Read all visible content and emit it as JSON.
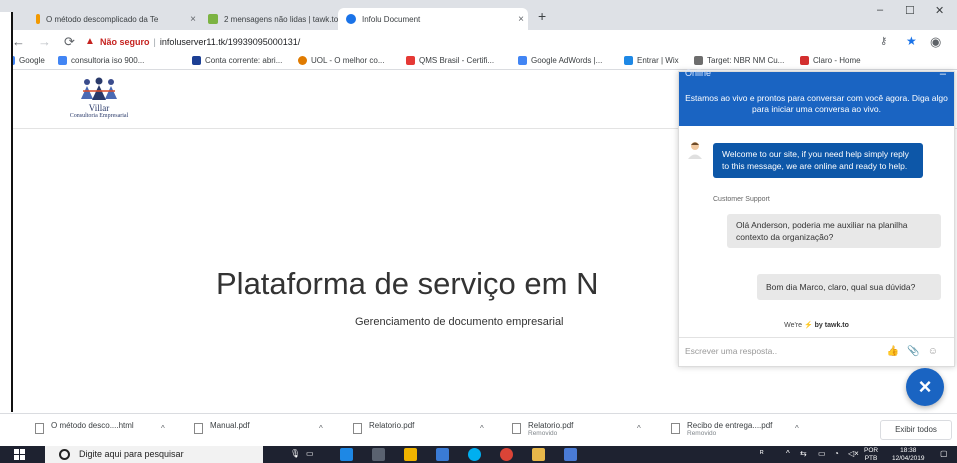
{
  "browser": {
    "tabs": [
      {
        "title": "O método descomplicado da Te",
        "icon_color": "#f29900",
        "active": false
      },
      {
        "title": "2 mensagens não lidas | tawk.to",
        "icon_color": "#7cb342",
        "active": false
      },
      {
        "title": "Infolu Document",
        "icon_color": "#1a73e8",
        "active": true
      }
    ],
    "new_tab_label": "+",
    "window_controls": [
      "–",
      "☐",
      "✕"
    ],
    "address": {
      "security": "Não seguro",
      "url": "infoluserver11.tk/19939095000131/"
    },
    "bookmarks": [
      {
        "label": "Google",
        "icon_color": "#4285f4"
      },
      {
        "label": "consultoria iso 900...",
        "icon_color": "#4285f4"
      },
      {
        "label": "Conta corrente: abri...",
        "icon_color": "#1c3f94"
      },
      {
        "label": "UOL - O melhor co...",
        "icon_color": "#e07b00"
      },
      {
        "label": "QMS Brasil - Certifi...",
        "icon_color": "#e53935"
      },
      {
        "label": "Google AdWords |...",
        "icon_color": "#4285f4"
      },
      {
        "label": "Entrar | Wix",
        "icon_color": "#1e88e5"
      },
      {
        "label": "Target: NBR NM Cu...",
        "icon_color": "#6d6d6d"
      },
      {
        "label": "Claro - Home",
        "icon_color": "#d32f2f"
      }
    ]
  },
  "site": {
    "logo_name": "Villar",
    "logo_sub": "Consultoria Empresarial",
    "hero_title": "Plataforma de serviço em N",
    "hero_subtitle": "Gerenciamento de documento empresarial"
  },
  "chat": {
    "status": "Online",
    "minimize": "–",
    "intro": "Estamos ao vivo e prontos para conversar com você agora. Diga algo para iniciar uma conversa ao vivo.",
    "agent_message": "Welcome to our site, if you need help simply reply to this message, we are online and ready to help.",
    "agent_name": "Customer Support",
    "user_message_1": "Olá Anderson, poderia me auxiliar na planilha contexto da organização?",
    "user_message_2": "Bom dia Marco, claro, qual sua dúvida?",
    "powered_prefix": "We're",
    "powered_brand": "by tawk.to",
    "input_placeholder": "Escrever uma resposta..",
    "brand_color": "#1a64c2"
  },
  "downloads": {
    "items": [
      {
        "name": "O método desco....html",
        "status": ""
      },
      {
        "name": "Manual.pdf",
        "status": ""
      },
      {
        "name": "Relatorio.pdf",
        "status": ""
      },
      {
        "name": "Relatorio.pdf",
        "status": "Removido"
      },
      {
        "name": "Recibo de entrega....pdf",
        "status": "Removido"
      }
    ],
    "show_all": "Exibir todos"
  },
  "taskbar": {
    "search_placeholder": "Digite aqui para pesquisar",
    "lang_top": "POR",
    "lang_bottom": "PTB",
    "time": "18:38",
    "date": "12/04/2019"
  }
}
